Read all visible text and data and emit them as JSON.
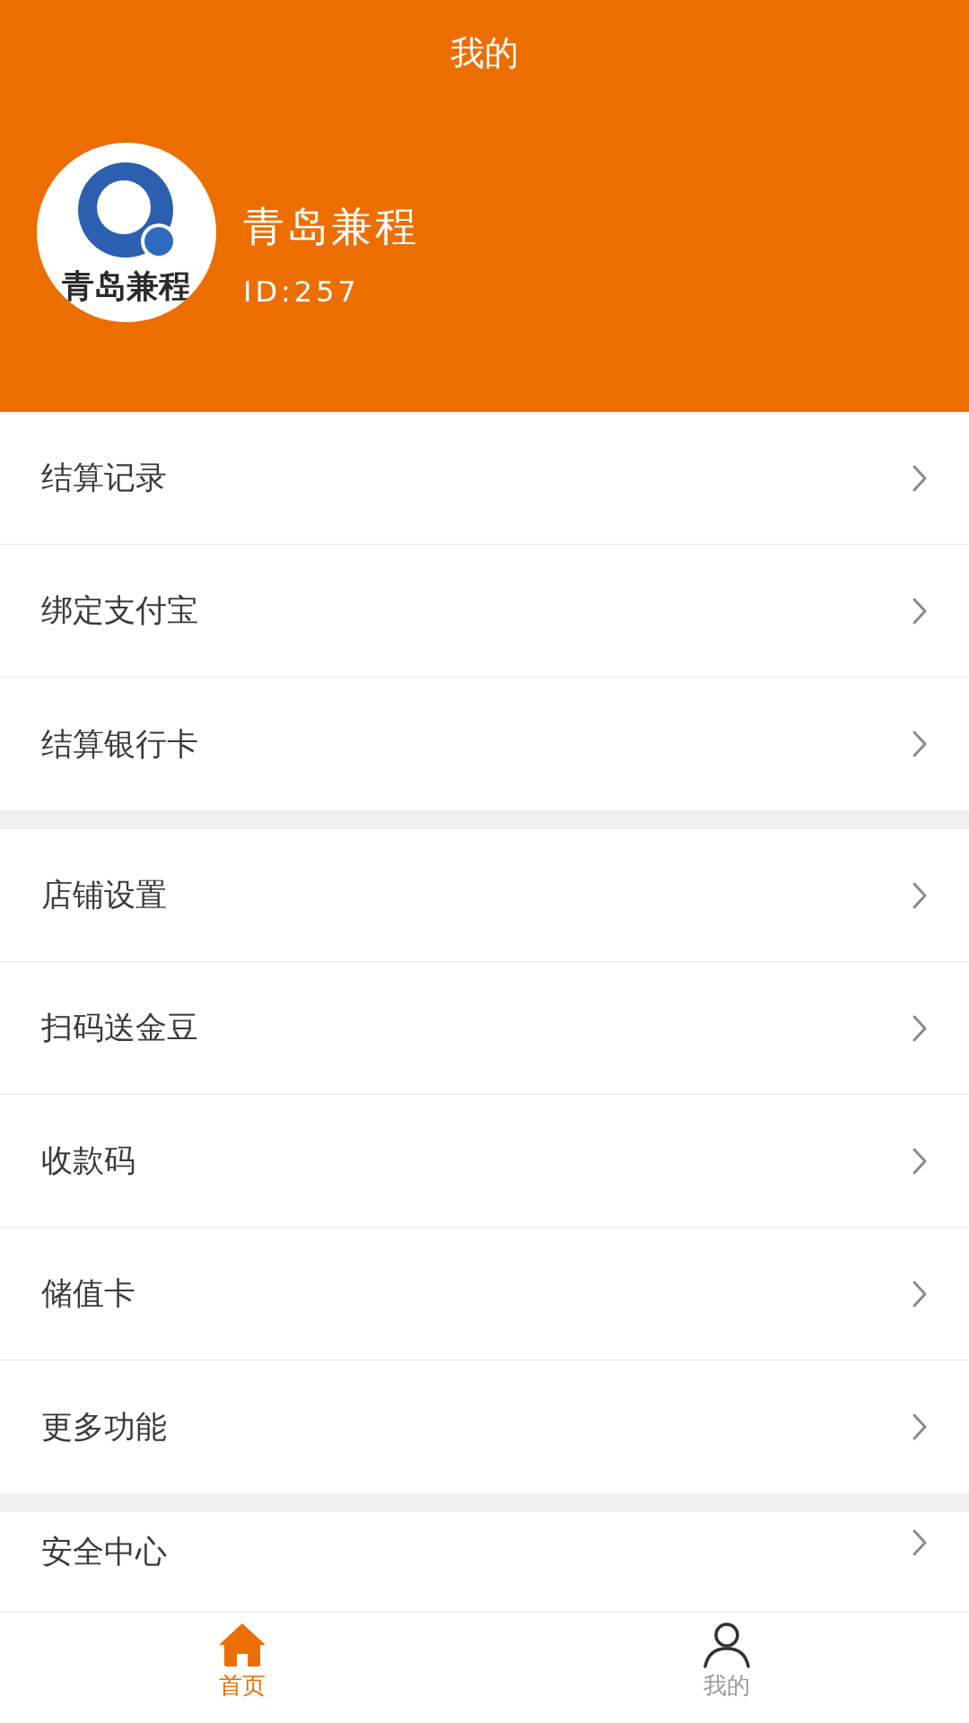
{
  "title": "我的",
  "profile": {
    "logo_text": "青岛兼程",
    "name": "青岛兼程",
    "id": "ID:257"
  },
  "menu_groups": [
    {
      "items": [
        {
          "label": "结算记录"
        },
        {
          "label": "绑定支付宝"
        },
        {
          "label": "结算银行卡"
        }
      ]
    },
    {
      "items": [
        {
          "label": "店铺设置"
        },
        {
          "label": "扫码送金豆"
        },
        {
          "label": "收款码"
        },
        {
          "label": "储值卡"
        },
        {
          "label": "更多功能"
        }
      ]
    },
    {
      "items": [
        {
          "label": "安全中心"
        }
      ]
    }
  ],
  "tab_bar": [
    {
      "label": "首页",
      "selected": true
    },
    {
      "label": "我的",
      "selected": false
    }
  ]
}
